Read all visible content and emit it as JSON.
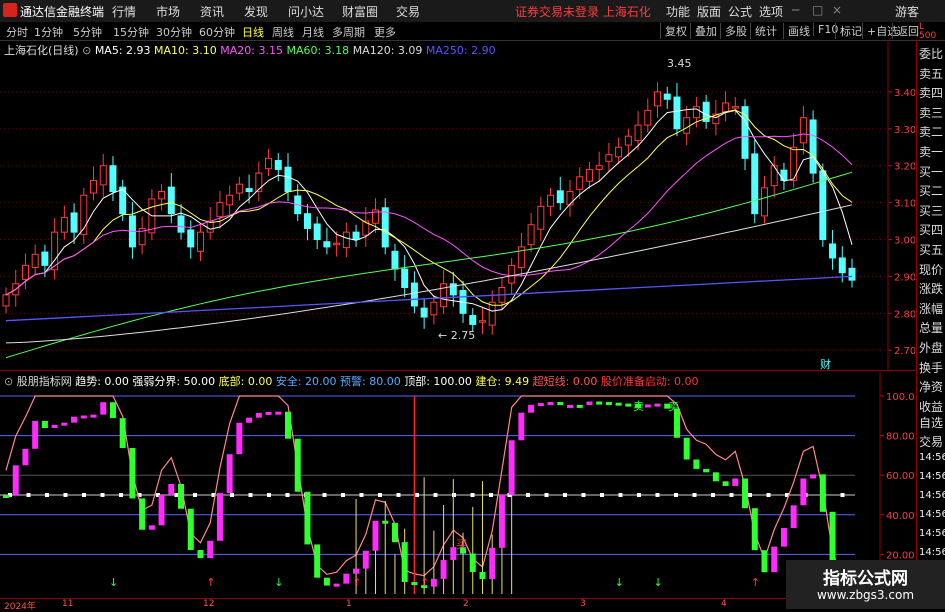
{
  "app": {
    "title": "通达信金融终端"
  },
  "menu": [
    "行情",
    "市场",
    "资讯",
    "发现",
    "问小达",
    "财富圈",
    "交易"
  ],
  "status_alert": "证券交易未登录  上海石化",
  "right_menu": [
    "功能",
    "版面",
    "公式",
    "选项"
  ],
  "user_label": "游客",
  "timeframes": [
    "分时",
    "1分钟",
    "5分钟",
    "15分钟",
    "30分钟",
    "60分钟",
    "日线",
    "周线",
    "月线",
    "多周期",
    "更多"
  ],
  "active_timeframe": "日线",
  "toolbar_buttons": [
    "复权",
    "叠加",
    "多股",
    "统计",
    "画线",
    "F10",
    "标记",
    "+自选",
    "返回"
  ],
  "stock": {
    "name": "上海石化(日线)"
  },
  "ma_legend": [
    {
      "label": "MA5: 2.93",
      "color": "#ffffff"
    },
    {
      "label": "MA10: 3.10",
      "color": "#ffff55"
    },
    {
      "label": "MA20: 3.15",
      "color": "#ff55ff"
    },
    {
      "label": "MA60: 3.18",
      "color": "#55ff55"
    },
    {
      "label": "MA120: 3.09",
      "color": "#dddddd"
    },
    {
      "label": "MA250: 2.90",
      "color": "#5555ff"
    }
  ],
  "price_labels": [
    "3.40",
    "3.30",
    "3.20",
    "3.10",
    "3.00",
    "2.90",
    "2.80",
    "2.70"
  ],
  "annotations": {
    "high": "3.45",
    "low": "2.75",
    "fin_marker": "财"
  },
  "indicator": {
    "name": "股朋指标网",
    "legend": [
      {
        "label": "趋势: 0.00",
        "color": "#ffffff"
      },
      {
        "label": "强弱分界: 50.00",
        "color": "#ffffff"
      },
      {
        "label": "底部: 0.00",
        "color": "#ffff55"
      },
      {
        "label": "安全: 20.00",
        "color": "#55aaff"
      },
      {
        "label": "预警: 80.00",
        "color": "#55aaff"
      },
      {
        "label": "顶部: 100.00",
        "color": "#ffffff"
      },
      {
        "label": "建仓: 9.49",
        "color": "#ffff55"
      },
      {
        "label": "超短线: 0.00",
        "color": "#ff5555"
      },
      {
        "label": "股价准备启动: 0.00",
        "color": "#ff3333"
      }
    ],
    "level_labels": [
      "100.00",
      "80.00",
      "60.00",
      "40.00",
      "20.00"
    ],
    "signals": {
      "sell": "卖",
      "buy": "买"
    }
  },
  "side_items": [
    "委比",
    "卖五",
    "卖四",
    "卖三",
    "卖二",
    "卖一",
    "买一",
    "买二",
    "买三",
    "买四",
    "买五",
    "现价",
    "涨跌",
    "涨幅",
    "总量",
    "外盘",
    "换手",
    "净资",
    "收益"
  ],
  "side_lower": [
    "自选",
    "交易",
    "14:56",
    "14:56",
    "14:56",
    "14:56",
    "14:56",
    "14:56",
    "14:56",
    "14:56"
  ],
  "side_top": [
    "L",
    "500"
  ],
  "date_axis": [
    "2024年",
    "11",
    "12",
    "1",
    "2",
    "3",
    "4"
  ],
  "watermark": {
    "line1": "指标公式网",
    "line2": "www.zbgs3.com"
  },
  "colors": {
    "up": "#ff3b3b",
    "down": "#54ffff",
    "accent_red": "#d4241c",
    "magenta": "#ff2bff",
    "green": "#30ff30"
  },
  "chart_data": {
    "type": "candlestick",
    "price_range": [
      2.66,
      3.5
    ],
    "closes": [
      2.85,
      2.88,
      2.93,
      2.96,
      2.93,
      3.02,
      3.06,
      3.02,
      3.12,
      3.16,
      3.2,
      3.13,
      3.07,
      2.98,
      3.03,
      3.11,
      3.13,
      3.07,
      3.02,
      2.98,
      3.02,
      3.05,
      3.1,
      3.12,
      3.15,
      3.13,
      3.18,
      3.22,
      3.19,
      3.13,
      3.07,
      3.03,
      3.0,
      2.98,
      2.99,
      3.02,
      3.0,
      3.05,
      3.08,
      2.98,
      2.92,
      2.87,
      2.82,
      2.79,
      2.83,
      2.88,
      2.85,
      2.8,
      2.77,
      2.78,
      2.83,
      2.87,
      2.93,
      2.98,
      3.04,
      3.09,
      3.12,
      3.1,
      3.13,
      3.17,
      3.19,
      3.2,
      3.23,
      3.25,
      3.28,
      3.31,
      3.35,
      3.4,
      3.38,
      3.3,
      3.33,
      3.36,
      3.32,
      3.34,
      3.37,
      3.36,
      3.22,
      3.07,
      3.14,
      3.2,
      3.16,
      3.25,
      3.33,
      3.18,
      3.0,
      2.95,
      2.91,
      2.89
    ],
    "ma250": [
      2.78,
      2.9
    ]
  }
}
